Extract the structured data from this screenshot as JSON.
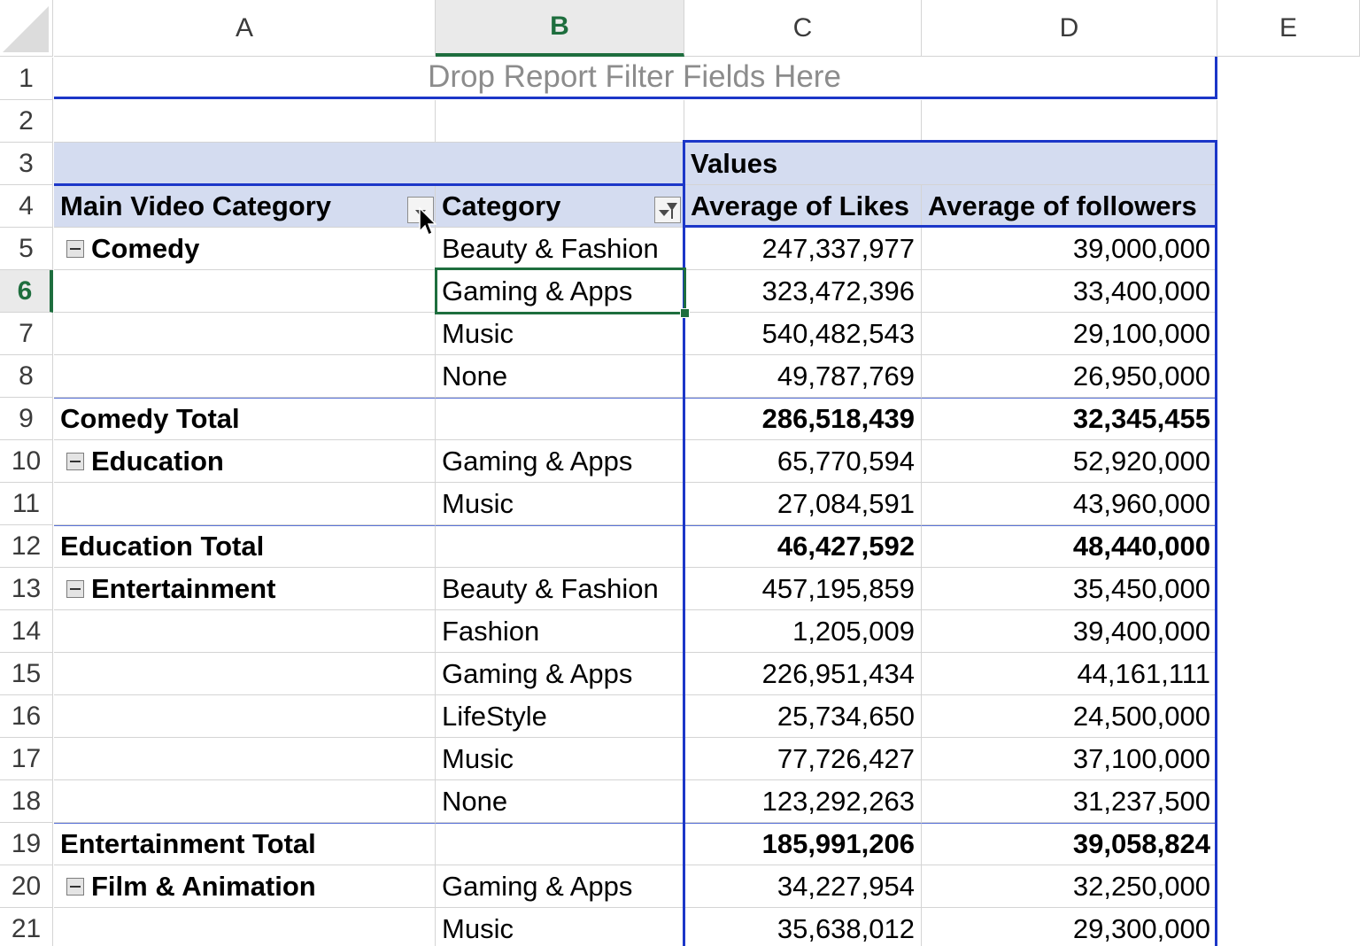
{
  "columns": [
    "A",
    "B",
    "C",
    "D",
    "E"
  ],
  "selected_column": "B",
  "rows": [
    "1",
    "2",
    "3",
    "4",
    "5",
    "6",
    "7",
    "8",
    "9",
    "10",
    "11",
    "12",
    "13",
    "14",
    "15",
    "16",
    "17",
    "18",
    "19",
    "20",
    "21"
  ],
  "selected_row": "6",
  "pivot": {
    "filter_placeholder": "Drop Report Filter Fields Here",
    "values_label": "Values",
    "headers": {
      "main_category": "Main Video Category",
      "category": "Category",
      "avg_likes": "Average of Likes",
      "avg_followers": "Average of followers"
    },
    "body": [
      {
        "main": "Comedy",
        "collapse": true,
        "category": "Beauty & Fashion",
        "likes": "247,337,977",
        "followers": "39,000,000"
      },
      {
        "main": "",
        "category": "Gaming & Apps",
        "likes": "323,472,396",
        "followers": "33,400,000"
      },
      {
        "main": "",
        "category": "Music",
        "likes": "540,482,543",
        "followers": "29,100,000"
      },
      {
        "main": "",
        "category": "None",
        "likes": "49,787,769",
        "followers": "26,950,000"
      },
      {
        "main": "Comedy Total",
        "total": true,
        "category": "",
        "likes": "286,518,439",
        "followers": "32,345,455"
      },
      {
        "main": "Education",
        "collapse": true,
        "category": "Gaming & Apps",
        "likes": "65,770,594",
        "followers": "52,920,000"
      },
      {
        "main": "",
        "category": "Music",
        "likes": "27,084,591",
        "followers": "43,960,000"
      },
      {
        "main": "Education Total",
        "total": true,
        "category": "",
        "likes": "46,427,592",
        "followers": "48,440,000"
      },
      {
        "main": "Entertainment",
        "collapse": true,
        "category": "Beauty & Fashion",
        "likes": "457,195,859",
        "followers": "35,450,000"
      },
      {
        "main": "",
        "category": "Fashion",
        "likes": "1,205,009",
        "followers": "39,400,000"
      },
      {
        "main": "",
        "category": "Gaming & Apps",
        "likes": "226,951,434",
        "followers": "44,161,111"
      },
      {
        "main": "",
        "category": "LifeStyle",
        "likes": "25,734,650",
        "followers": "24,500,000"
      },
      {
        "main": "",
        "category": "Music",
        "likes": "77,726,427",
        "followers": "37,100,000"
      },
      {
        "main": "",
        "category": "None",
        "likes": "123,292,263",
        "followers": "31,237,500"
      },
      {
        "main": "Entertainment Total",
        "total": true,
        "category": "",
        "likes": "185,991,206",
        "followers": "39,058,824"
      },
      {
        "main": "Film & Animation",
        "collapse": true,
        "category": "Gaming & Apps",
        "likes": "34,227,954",
        "followers": "32,250,000"
      },
      {
        "main": "",
        "category": "Music",
        "likes": "35,638,012",
        "followers": "29,300,000"
      }
    ]
  },
  "icons": {
    "collapse": "minus-box-icon",
    "dropdown": "dropdown-arrow-icon",
    "filter": "filter-funnel-icon",
    "cursor": "mouse-pointer-icon"
  },
  "colors": {
    "pivot_border": "#1c37c8",
    "header_band": "#d4dcf0",
    "selection": "#1e6e3e"
  }
}
